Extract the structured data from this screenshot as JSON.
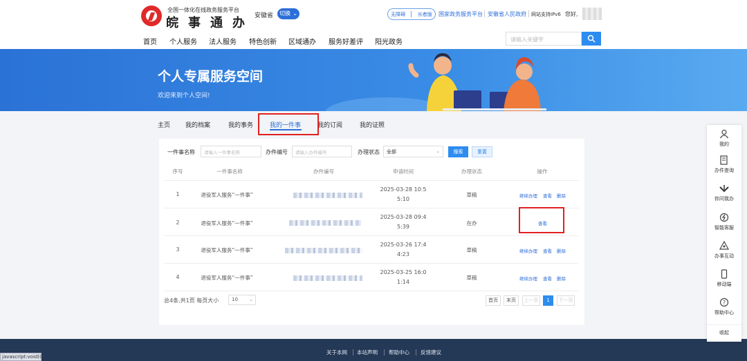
{
  "header": {
    "logo_top": "全国一体化在线政务服务平台",
    "logo_main": "皖事通办",
    "province": "安徽省",
    "switch_label": "切换",
    "accessibility": "无障碍",
    "elder": "长者版",
    "links": [
      "国家政务服务平台",
      "安徽省人民政府"
    ],
    "ipv6": "网站支持IPv6",
    "hello": "您好,"
  },
  "nav": {
    "items": [
      "首页",
      "个人服务",
      "法人服务",
      "特色创新",
      "区域通办",
      "服务好差评",
      "阳光政务"
    ],
    "search_placeholder": "请输入关键字"
  },
  "banner": {
    "title": "个人专属服务空间",
    "subtitle": "欢迎来到个人空间!"
  },
  "tabs": [
    "主页",
    "我的档案",
    "我的事务",
    "我的一件事",
    "我的订阅",
    "我的证照"
  ],
  "filters": {
    "name_label": "一件事名称",
    "name_placeholder": "请输入一件事名称",
    "code_label": "办件编号",
    "code_placeholder": "请输入办件编号",
    "status_label": "办理状态",
    "status_value": "全部",
    "search_btn": "搜索",
    "reset_btn": "重置"
  },
  "table": {
    "headers": [
      "序号",
      "一件事名称",
      "办件编号",
      "申请时间",
      "办理状态",
      "操作"
    ],
    "rows": [
      {
        "no": "1",
        "name": "退役军人服务“一件事”",
        "time1": "2025-03-28 10:5",
        "time2": "5:10",
        "status": "草稿",
        "ops": [
          "继续办理",
          "查看",
          "删除"
        ]
      },
      {
        "no": "2",
        "name": "退役军人服务“一件事”",
        "time1": "2025-03-28 09:4",
        "time2": "5:39",
        "status": "在办",
        "ops": [
          "查看"
        ]
      },
      {
        "no": "3",
        "name": "退役军人服务“一件事”",
        "time1": "2025-03-26 17:4",
        "time2": "4:23",
        "status": "草稿",
        "ops": [
          "继续办理",
          "查看",
          "删除"
        ]
      },
      {
        "no": "4",
        "name": "退役军人服务“一件事”",
        "time1": "2025-03-25 16:0",
        "time2": "1:14",
        "status": "草稿",
        "ops": [
          "继续办理",
          "查看",
          "删除"
        ]
      }
    ]
  },
  "pagination": {
    "total": "总4条,共1页",
    "page_size_label": "每页大小",
    "page_size": "10",
    "first": "首页",
    "last": "末页",
    "prev": "上一页",
    "current": "1",
    "next": "下一页"
  },
  "sidebar": [
    "我的",
    "办件查询",
    "你问我办",
    "智能客服",
    "办事互动",
    "移动端",
    "帮助中心",
    "收起"
  ],
  "footer": [
    "关于本网",
    "本站声明",
    "帮助中心",
    "反馈建议"
  ],
  "status_bar": "javascript:void(0)",
  "colors": {
    "primary": "#2d6fd9",
    "highlight_box": "#e02020",
    "footer_bg": "#243956"
  }
}
